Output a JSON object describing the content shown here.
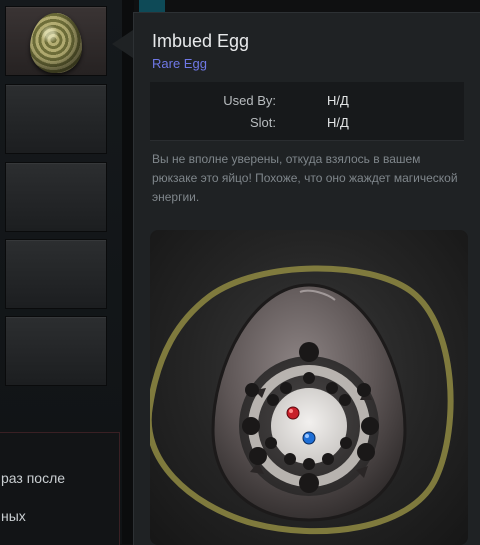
{
  "inventory": {
    "slots": [
      "imbued-egg",
      "empty",
      "empty",
      "empty",
      "empty"
    ]
  },
  "chat": {
    "lines": [
      "раз после",
      "ных"
    ]
  },
  "tooltip": {
    "title": "Imbued Egg",
    "rarity": "Rare Egg",
    "rarity_color": "#6f78e6",
    "stats": [
      {
        "label": "Used By:",
        "value": "Н/Д"
      },
      {
        "label": "Slot:",
        "value": "Н/Д"
      }
    ],
    "description": "Вы не вполне уверены, откуда взялось в вашем рюкзаке это яйцо! Похоже, что оно жаждет магической энергии."
  },
  "colors": {
    "annotation_circle": "#8a8440",
    "red_dot": "#c8202a",
    "blue_dot": "#1f6fd6"
  }
}
